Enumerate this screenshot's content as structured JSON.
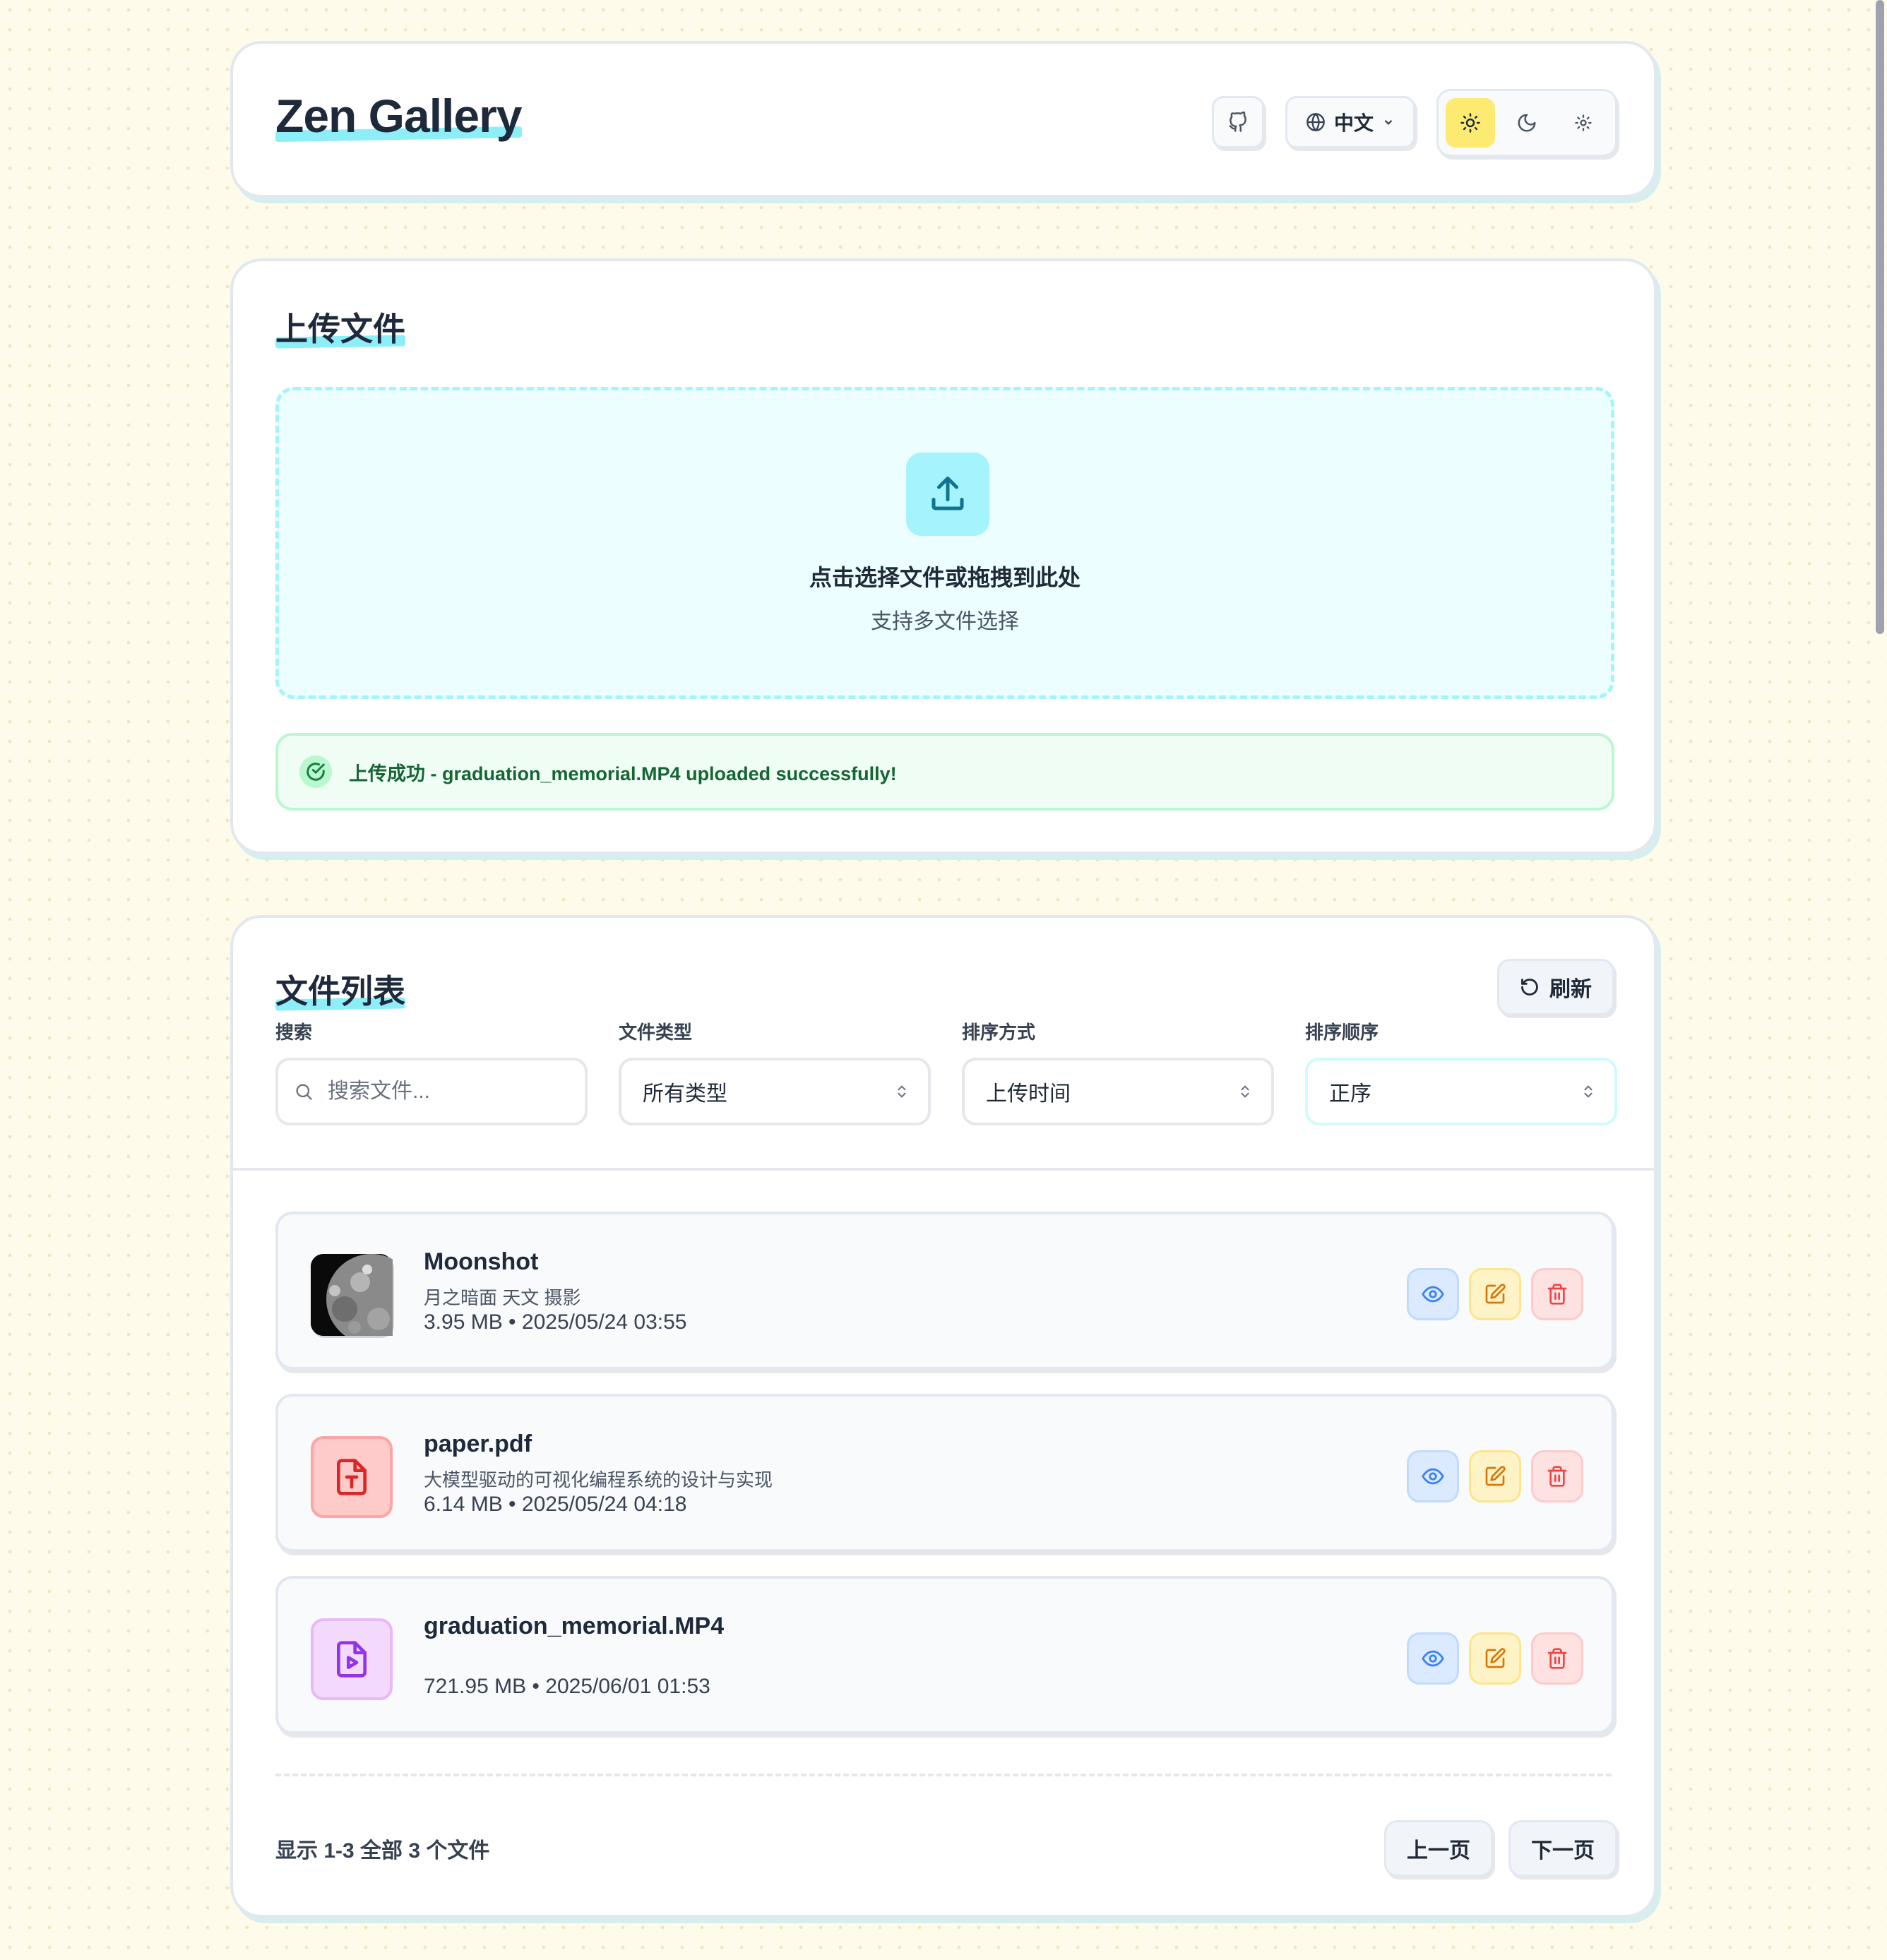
{
  "header": {
    "title": "Zen Gallery",
    "github_icon": "github-icon",
    "language_label": "中文",
    "theme_options": [
      "sun-icon",
      "moon-icon",
      "system-theme-icon"
    ],
    "active_theme": "light",
    "active_theme_color": "#fdeb71"
  },
  "upload": {
    "title": "上传文件",
    "drop_text": "点击选择文件或拖拽到此处",
    "drop_subtext": "支持多文件选择",
    "success_message": "上传成功 - graduation_memorial.MP4 uploaded successfully!"
  },
  "files": {
    "title": "文件列表",
    "refresh_label": "刷新",
    "filters": {
      "search_label": "搜索",
      "search_placeholder": "搜索文件...",
      "type_label": "文件类型",
      "type_value": "所有类型",
      "sort_label": "排序方式",
      "sort_value": "上传时间",
      "order_label": "排序顺序",
      "order_value": "正序"
    },
    "items": [
      {
        "name": "Moonshot",
        "description": "月之暗面 天文 摄影",
        "meta": "3.95 MB • 2025/05/24 03:55",
        "kind": "image",
        "thumb_icon": "moon-photo-thumbnail"
      },
      {
        "name": "paper.pdf",
        "description": "大模型驱动的可视化编程系统的设计与实现",
        "meta": "6.14 MB • 2025/05/24 04:18",
        "kind": "pdf",
        "thumb_icon": "pdf-file-icon"
      },
      {
        "name": "graduation_memorial.MP4",
        "description": "",
        "meta": "721.95 MB • 2025/06/01 01:53",
        "kind": "video",
        "thumb_icon": "video-file-icon"
      }
    ],
    "actions": [
      "eye-icon",
      "edit-icon",
      "trash-icon"
    ],
    "pagination": {
      "info": "显示 1-3 全部 3 个文件",
      "prev_label": "上一页",
      "next_label": "下一页"
    }
  },
  "colors": {
    "accent": "#8deef8",
    "upload_zone_bg": "#ecfeff",
    "success_bg": "#f0fdf4",
    "success_text": "#166534",
    "pdf_red": "#dc2626",
    "video_purple": "#9333ea"
  }
}
